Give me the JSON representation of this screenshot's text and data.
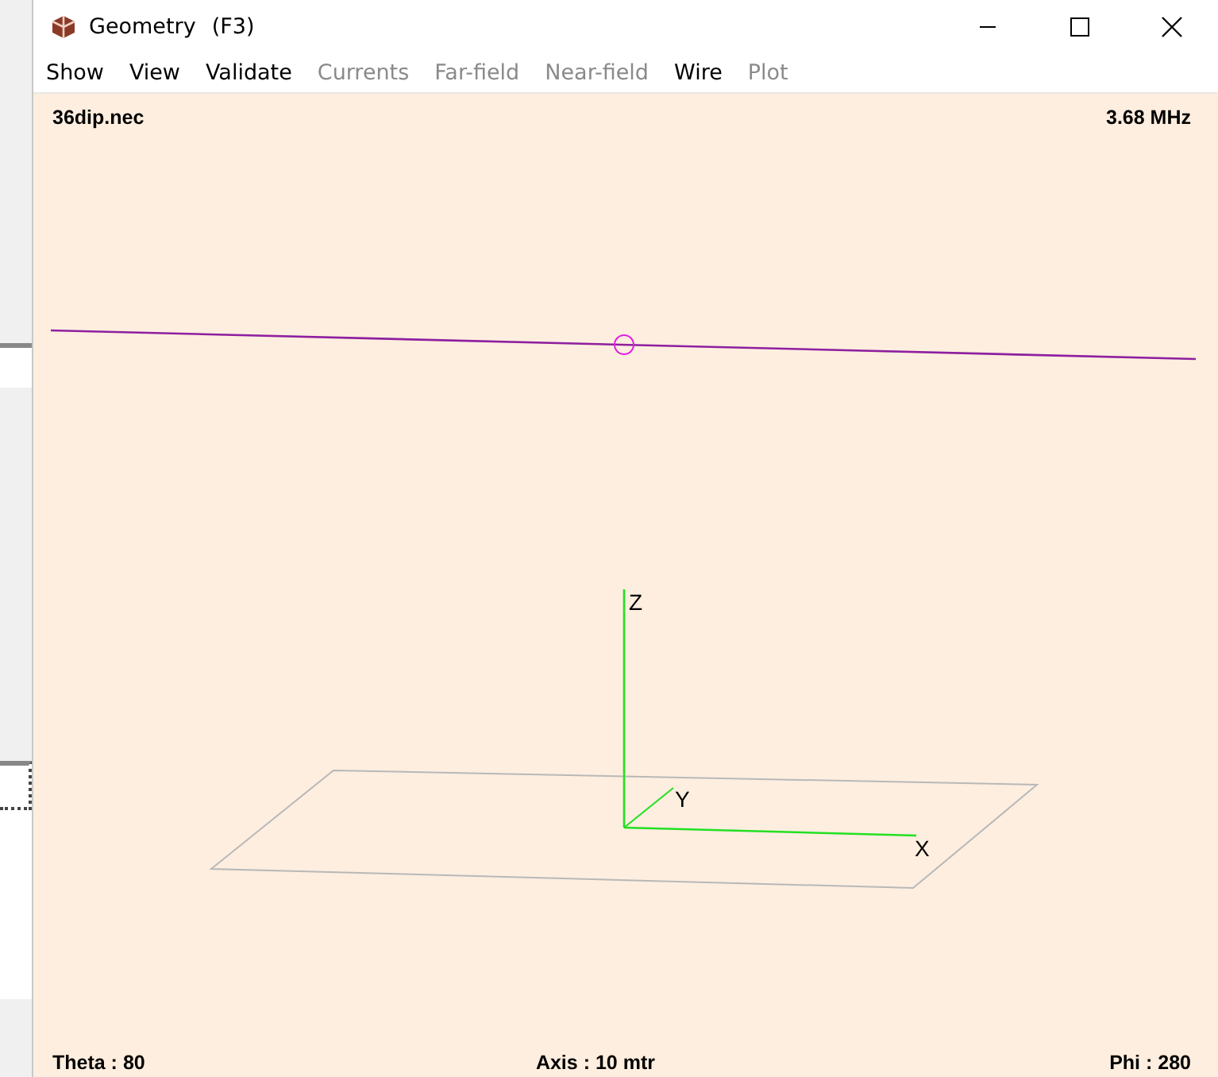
{
  "window": {
    "title": "Geometry",
    "shortcut": "(F3)"
  },
  "menu": [
    {
      "label": "Show",
      "disabled": false
    },
    {
      "label": "View",
      "disabled": false
    },
    {
      "label": "Validate",
      "disabled": false
    },
    {
      "label": "Currents",
      "disabled": true
    },
    {
      "label": "Far-field",
      "disabled": true
    },
    {
      "label": "Near-field",
      "disabled": true
    },
    {
      "label": "Wire",
      "disabled": false
    },
    {
      "label": "Plot",
      "disabled": true
    }
  ],
  "canvas": {
    "file": "36dip.nec",
    "frequency": "3.68 MHz",
    "axis_labels": [
      "Z",
      "Y",
      "X"
    ],
    "theta": "Theta : 80",
    "axis": "Axis : 10 mtr",
    "phi": "Phi : 280"
  }
}
